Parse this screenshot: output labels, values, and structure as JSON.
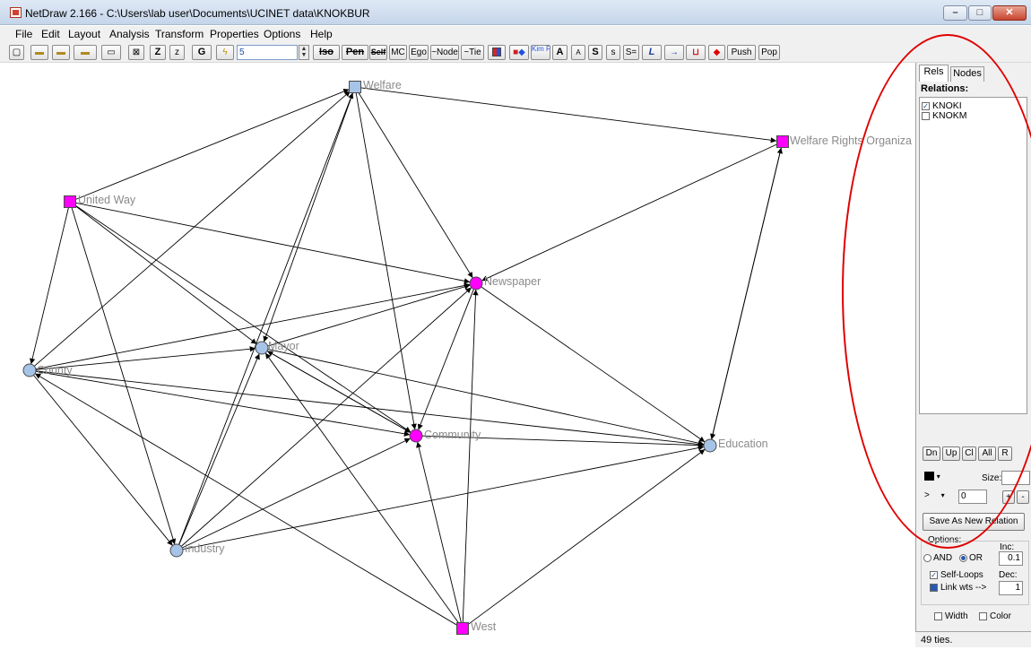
{
  "window": {
    "title": "NetDraw 2.166 - C:\\Users\\lab user\\Documents\\UCINET data\\KNOKBUR"
  },
  "menu": [
    "File",
    "Edit",
    "Layout",
    "Analysis",
    "Transform",
    "Properties",
    "Options",
    "Help"
  ],
  "toolbar": {
    "buttons": [
      "Z",
      "z",
      "G",
      "Iso",
      "Pen",
      "Self",
      "MC",
      "Ego",
      "~Node",
      "~Tie",
      "Kim Fill",
      "A",
      "A",
      "S",
      "s",
      "S=",
      "L",
      "Push",
      "Pop"
    ],
    "input_value": "5"
  },
  "network": {
    "nodes": [
      {
        "id": "welfare",
        "label": "Welfare",
        "shape": "square",
        "color": "#a6c4e8"
      },
      {
        "id": "wro",
        "label": "Welfare Rights Organiza",
        "shape": "square",
        "color": "#ff00ff"
      },
      {
        "id": "unitedway",
        "label": "United Way",
        "shape": "square",
        "color": "#ff00ff"
      },
      {
        "id": "newspaper",
        "label": "Newspaper",
        "shape": "circle",
        "color": "#ff00ff"
      },
      {
        "id": "mayor",
        "label": "Mayor",
        "shape": "circle",
        "color": "#a6c4e8"
      },
      {
        "id": "county",
        "label": "County",
        "shape": "circle",
        "color": "#a6c4e8"
      },
      {
        "id": "community",
        "label": "Community",
        "shape": "circle",
        "color": "#ff00ff"
      },
      {
        "id": "education",
        "label": "Education",
        "shape": "circle",
        "color": "#a6c4e8"
      },
      {
        "id": "industry",
        "label": "Industry",
        "shape": "circle",
        "color": "#a6c4e8"
      },
      {
        "id": "west",
        "label": "West",
        "shape": "square",
        "color": "#ff00ff"
      }
    ],
    "edges": [
      [
        "welfare",
        "wro"
      ],
      [
        "unitedway",
        "welfare"
      ],
      [
        "unitedway",
        "newspaper"
      ],
      [
        "unitedway",
        "mayor"
      ],
      [
        "unitedway",
        "community"
      ],
      [
        "unitedway",
        "county"
      ],
      [
        "unitedway",
        "industry"
      ],
      [
        "welfare",
        "newspaper"
      ],
      [
        "welfare",
        "community"
      ],
      [
        "welfare",
        "mayor"
      ],
      [
        "county",
        "welfare"
      ],
      [
        "industry",
        "welfare"
      ],
      [
        "county",
        "mayor"
      ],
      [
        "county",
        "newspaper"
      ],
      [
        "county",
        "community"
      ],
      [
        "county",
        "industry"
      ],
      [
        "county",
        "education"
      ],
      [
        "mayor",
        "newspaper"
      ],
      [
        "mayor",
        "community"
      ],
      [
        "community",
        "mayor"
      ],
      [
        "mayor",
        "education"
      ],
      [
        "newspaper",
        "community"
      ],
      [
        "community",
        "education"
      ],
      [
        "newspaper",
        "education"
      ],
      [
        "wro",
        "newspaper"
      ],
      [
        "wro",
        "education"
      ],
      [
        "education",
        "wro"
      ],
      [
        "industry",
        "mayor"
      ],
      [
        "industry",
        "community"
      ],
      [
        "industry",
        "newspaper"
      ],
      [
        "industry",
        "education"
      ],
      [
        "west",
        "mayor"
      ],
      [
        "west",
        "community"
      ],
      [
        "west",
        "newspaper"
      ],
      [
        "west",
        "education"
      ],
      [
        "west",
        "county"
      ]
    ]
  },
  "panel": {
    "tabs": [
      "Rels",
      "Nodes"
    ],
    "relations_title": "Relations:",
    "relations": [
      {
        "name": "KNOKI",
        "checked": true
      },
      {
        "name": "KNOKM",
        "checked": false
      }
    ],
    "buttons": [
      "Dn",
      "Up",
      "Cl",
      "All",
      "R"
    ],
    "size_label": "Size:",
    "operator": ">",
    "threshold": "0",
    "plus": "+",
    "minus": "-",
    "save_label": "Save As New Relation",
    "options_label": "Options:",
    "inc_label": "Inc:",
    "inc_value": "0.1",
    "and_label": "AND",
    "or_label": "OR",
    "self_loops_label": "Self-Loops",
    "dec_label": "Dec:",
    "dec_value": "1",
    "link_wts_label": "Link wts -->",
    "width_label": "Width",
    "color_label": "Color",
    "status": "49 ties."
  }
}
